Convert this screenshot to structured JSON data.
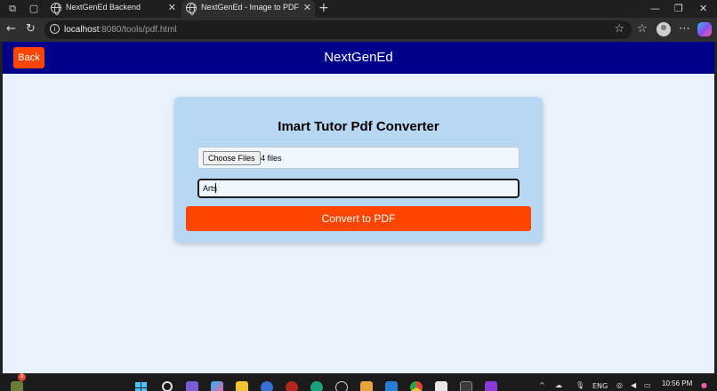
{
  "browser": {
    "tabs": [
      {
        "title": "NextGenEd Backend",
        "active": false
      },
      {
        "title": "NextGenEd - Image to PDF",
        "active": true
      }
    ],
    "url_host": "localhost",
    "url_path": ":8080/tools/pdf.html"
  },
  "app": {
    "header": {
      "back_label": "Back",
      "brand": "NextGenEd"
    },
    "converter": {
      "title": "Imart Tutor Pdf Converter",
      "choose_label": "Choose Files",
      "file_status": "4 files",
      "name_value": "Arts",
      "convert_label": "Convert to PDF"
    },
    "colors": {
      "header_bg": "#00008b",
      "accent": "#ff4500",
      "page_bg": "#e8f2fd",
      "card_bg": "#b8d7f3"
    }
  },
  "taskbar": {
    "notification_count": "3",
    "language": "ENG",
    "time": "10:56 PM"
  }
}
